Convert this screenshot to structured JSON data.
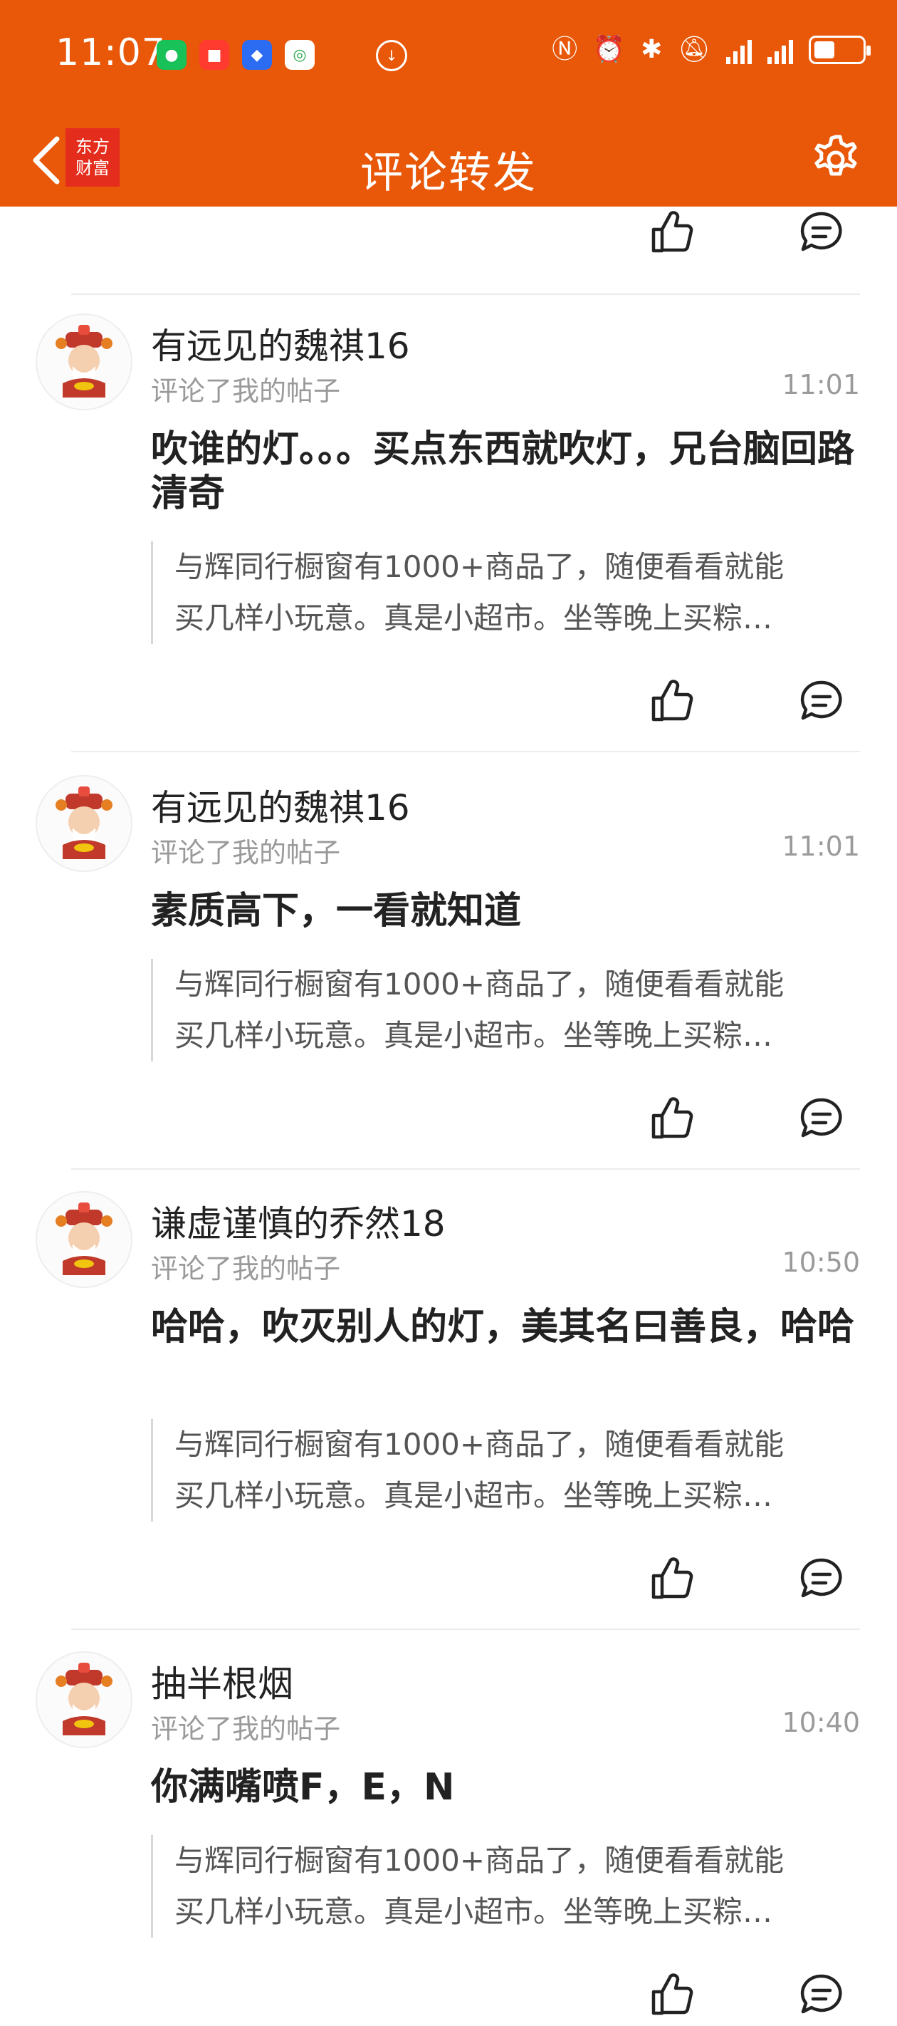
{
  "status_bar": {
    "time": "11:07",
    "notif_icons": [
      "wechat-icon",
      "red-book-icon",
      "blue-shield-icon",
      "mobile-carrier-icon"
    ],
    "right_icons": [
      "nfc-icon",
      "alarm-icon",
      "bluetooth-icon",
      "mute-icon",
      "signal-icon",
      "signal-icon",
      "battery-icon"
    ]
  },
  "header": {
    "title": "评论转发",
    "logo_line1": "东方",
    "logo_line2": "财富"
  },
  "colors": {
    "brand": "#e95708",
    "text": "#222222",
    "muted": "#9a9a9a",
    "quote_bar": "#d6d6d6"
  },
  "items": [
    {
      "user": "有远见的魏祺16",
      "subtitle": "评论了我的帖子",
      "time": "11:01",
      "comment": "吹谁的灯。。。买点东西就吹灯，兄台脑回路清奇",
      "quote_line1": "与辉同行橱窗有1000+商品了，随便看看就能",
      "quote_line2": "买几样小玩意。真是小超市。坐等晚上买粽…"
    },
    {
      "user": "有远见的魏祺16",
      "subtitle": "评论了我的帖子",
      "time": "11:01",
      "comment": "素质高下，一看就知道",
      "quote_line1": "与辉同行橱窗有1000+商品了，随便看看就能",
      "quote_line2": "买几样小玩意。真是小超市。坐等晚上买粽…"
    },
    {
      "user": "谦虚谨慎的乔然18",
      "subtitle": "评论了我的帖子",
      "time": "10:50",
      "comment": "哈哈，吹灭别人的灯，美其名曰善良，哈哈",
      "quote_line1": "与辉同行橱窗有1000+商品了，随便看看就能",
      "quote_line2": "买几样小玩意。真是小超市。坐等晚上买粽…"
    },
    {
      "user": "抽半根烟",
      "subtitle": "评论了我的帖子",
      "time": "10:40",
      "comment": "你满嘴喷F，E，N",
      "quote_line1": "与辉同行橱窗有1000+商品了，随便看看就能",
      "quote_line2": "买几样小玩意。真是小超市。坐等晚上买粽…"
    }
  ]
}
